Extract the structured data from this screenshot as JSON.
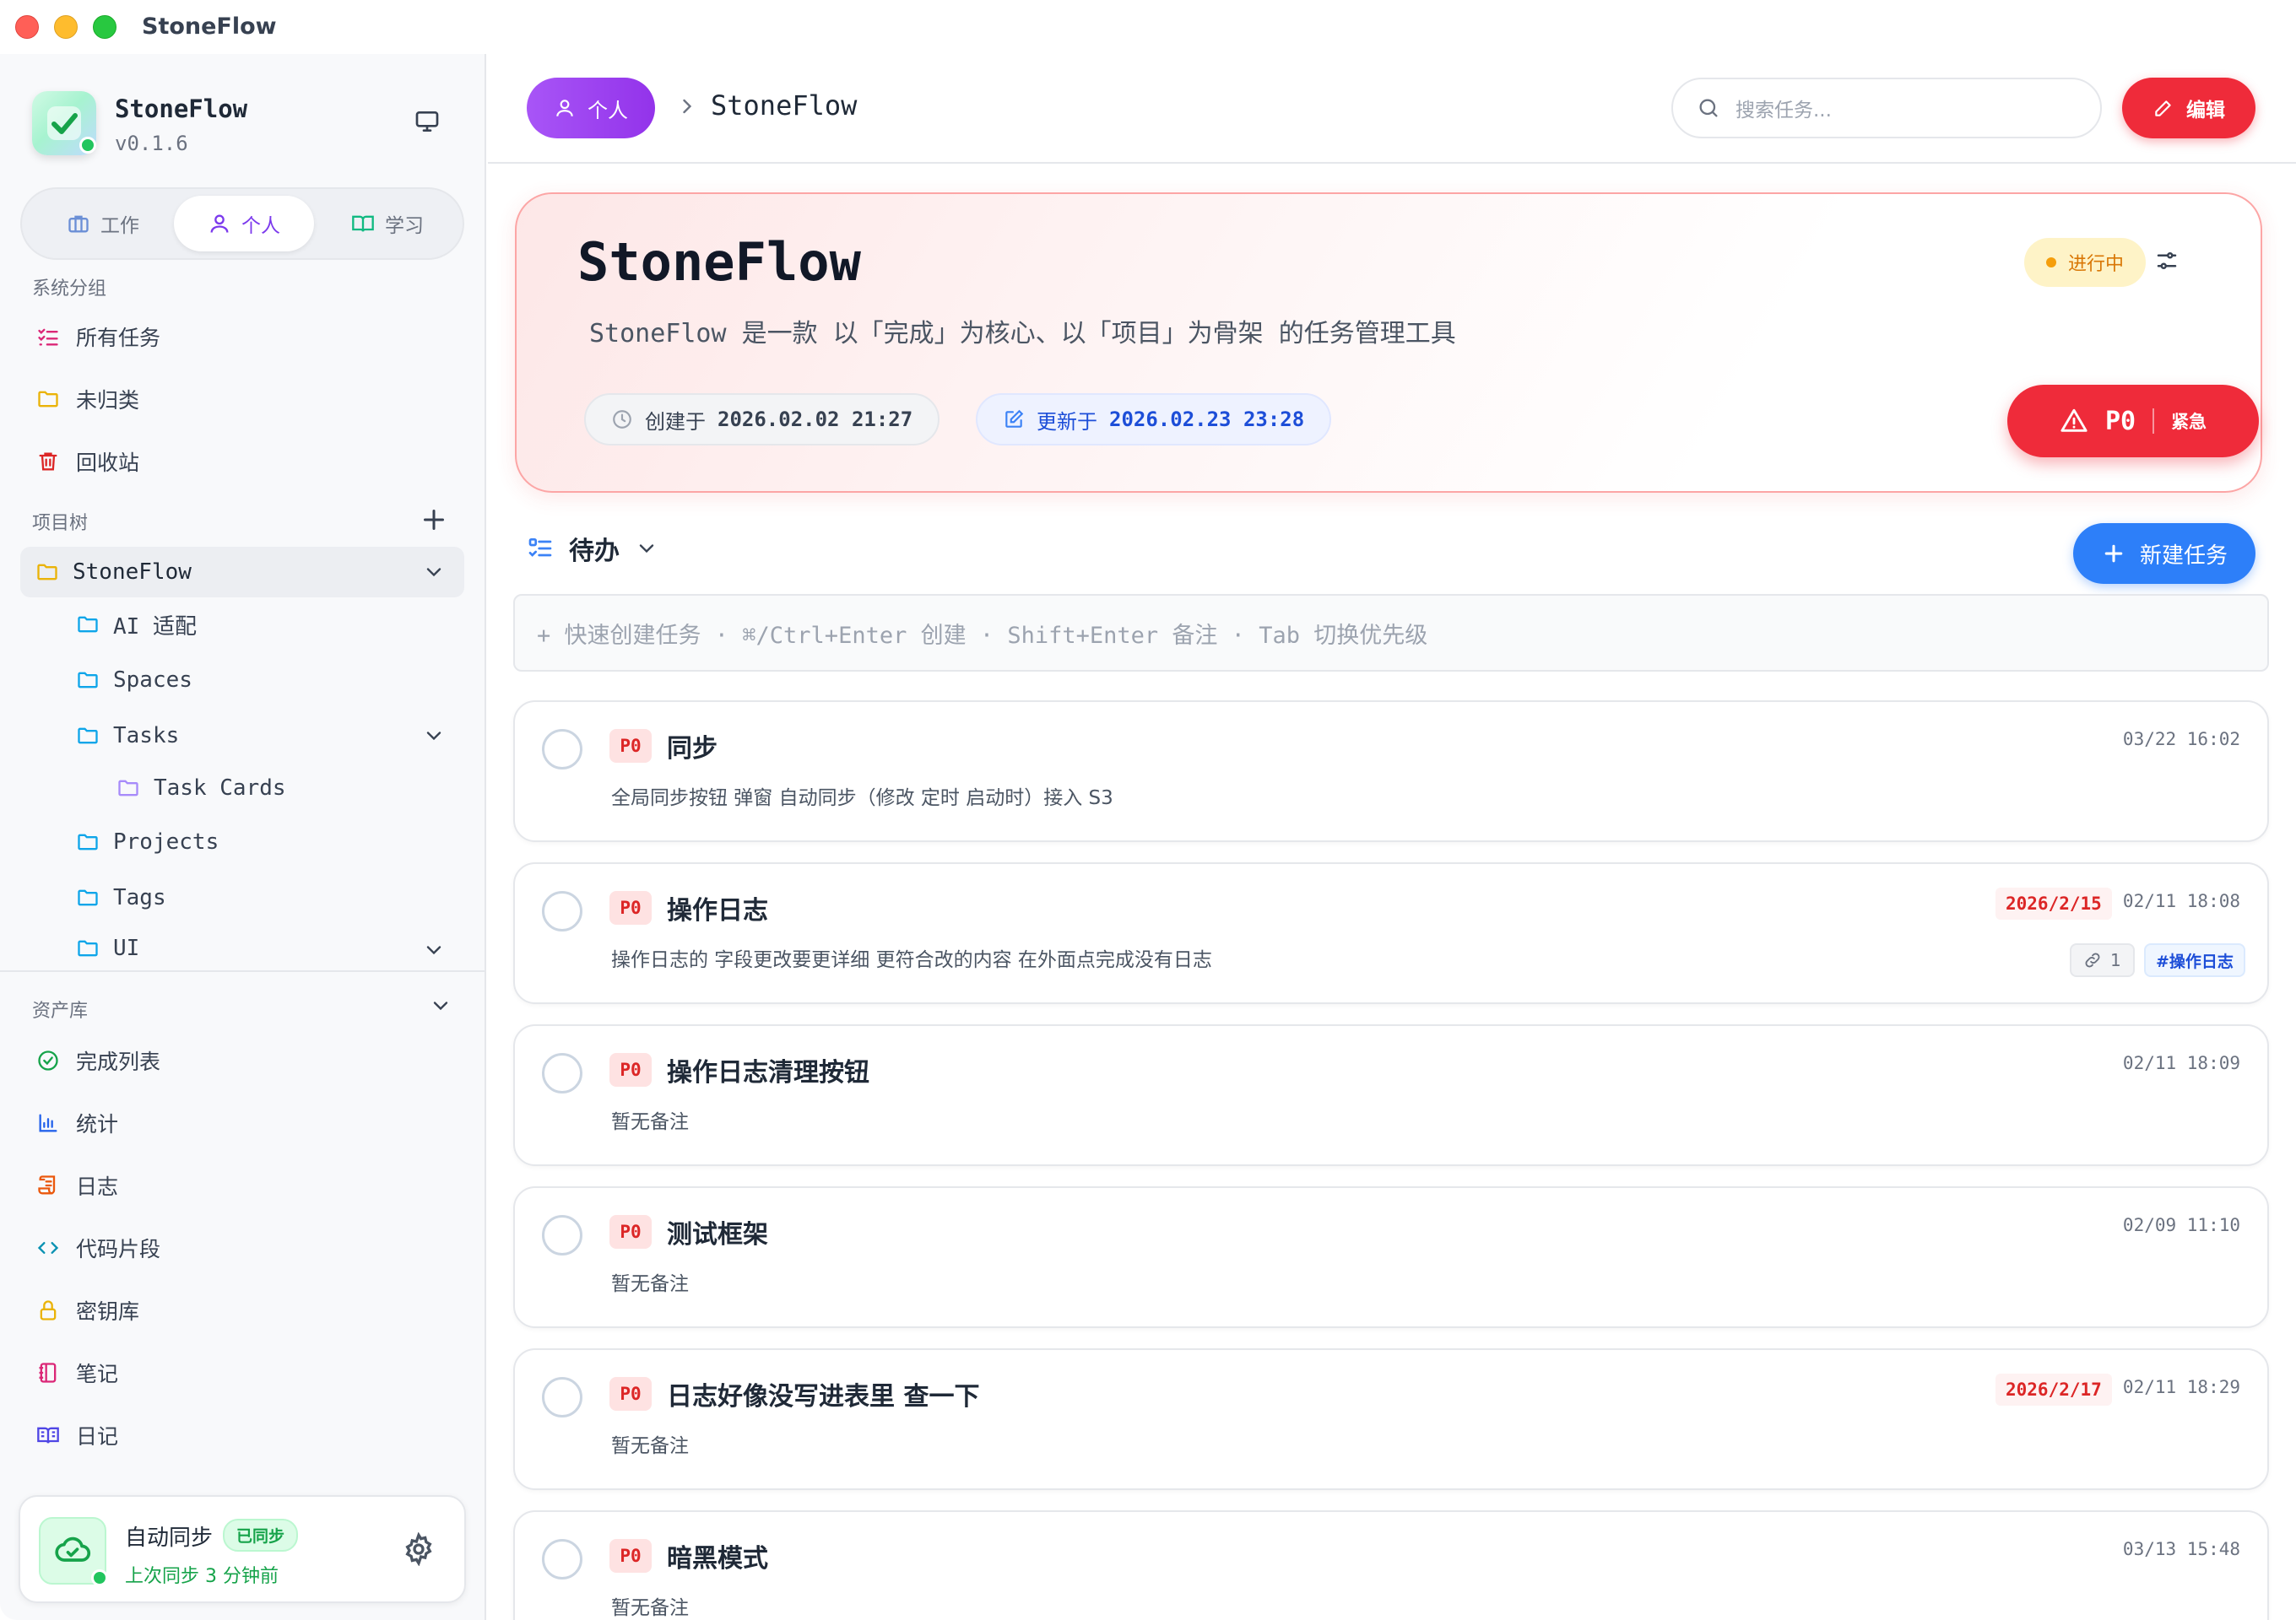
{
  "window": {
    "title": "StoneFlow"
  },
  "brand": {
    "name": "StoneFlow",
    "version": "v0.1.6"
  },
  "spaces": [
    {
      "label": "工作",
      "icon": "briefcase-icon"
    },
    {
      "label": "个人",
      "icon": "user-icon",
      "active": true
    },
    {
      "label": "学习",
      "icon": "book-icon"
    }
  ],
  "system_group": {
    "label": "系统分组",
    "items": [
      {
        "label": "所有任务",
        "icon": "list-check-icon",
        "color": "#db2777"
      },
      {
        "label": "未归类",
        "icon": "folder-icon",
        "color": "#eab308"
      },
      {
        "label": "回收站",
        "icon": "trash-icon",
        "color": "#dc2626"
      }
    ]
  },
  "project_tree": {
    "label": "项目树",
    "root": "StoneFlow",
    "items": [
      "AI 适配",
      "Spaces",
      "Tasks",
      "Task Cards",
      "Projects",
      "Tags",
      "UI"
    ]
  },
  "assets": {
    "label": "资产库",
    "items": [
      {
        "label": "完成列表",
        "icon": "circle-check-icon",
        "color": "#16a34a"
      },
      {
        "label": "统计",
        "icon": "bar-chart-icon",
        "color": "#2563eb"
      },
      {
        "label": "日志",
        "icon": "scroll-icon",
        "color": "#ea580c"
      },
      {
        "label": "代码片段",
        "icon": "code-icon",
        "color": "#0891b2"
      },
      {
        "label": "密钥库",
        "icon": "lock-icon",
        "color": "#eab308"
      },
      {
        "label": "笔记",
        "icon": "notebook-icon",
        "color": "#db2777"
      },
      {
        "label": "日记",
        "icon": "open-book-icon",
        "color": "#4f46e5"
      }
    ]
  },
  "sync": {
    "title": "自动同步",
    "badge": "已同步",
    "subtitle": "上次同步 3 分钟前"
  },
  "header": {
    "breadcrumb_space": "个人",
    "breadcrumb_project": "StoneFlow",
    "search_placeholder": "搜索任务...",
    "edit_label": "编辑"
  },
  "project": {
    "title": "StoneFlow",
    "description": "StoneFlow 是一款 以「完成」为核心、以「项目」为骨架 的任务管理工具",
    "status": "进行中",
    "created_label": "创建于",
    "created_at": "2026.02.02 21:27",
    "updated_label": "更新于",
    "updated_at": "2026.02.23 23:28",
    "priority": "P0",
    "priority_label": "紧急"
  },
  "list": {
    "title": "待办",
    "new_task_label": "新建任务",
    "quick_create_hint": "+ 快速创建任务 · ⌘/Ctrl+Enter 创建 · Shift+Enter 备注 · Tab 切换优先级"
  },
  "tasks": [
    {
      "priority": "P0",
      "title": "同步",
      "note": "全局同步按钮 弹窗 自动同步（修改 定时 启动时）接入 S3",
      "time": "03/22 16:02"
    },
    {
      "priority": "P0",
      "title": "操作日志",
      "note": "操作日志的 字段更改要更详细 更符合改的内容 在外面点完成没有日志",
      "time": "02/11 18:08",
      "due": "2026/2/15",
      "links": "1",
      "tag": "#操作日志"
    },
    {
      "priority": "P0",
      "title": "操作日志清理按钮",
      "note": "暂无备注",
      "time": "02/11 18:09"
    },
    {
      "priority": "P0",
      "title": "测试框架",
      "note": "暂无备注",
      "time": "02/09 11:10"
    },
    {
      "priority": "P0",
      "title": "日志好像没写进表里 查一下",
      "note": "暂无备注",
      "time": "02/11 18:29",
      "due": "2026/2/17"
    },
    {
      "priority": "P0",
      "title": "暗黑模式",
      "note": "暂无备注",
      "time": "03/13 15:48"
    }
  ]
}
